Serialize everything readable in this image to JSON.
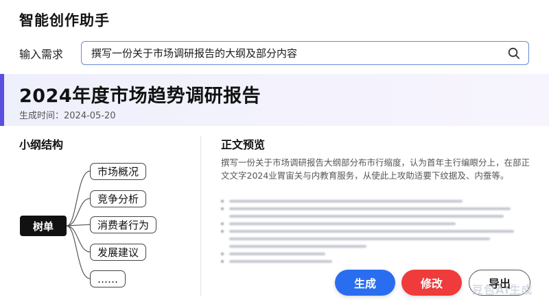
{
  "app": {
    "title": "智能创作助手"
  },
  "input": {
    "label": "输入需求",
    "value": "撰写一份关于市场调研报告的大纲及部分内容"
  },
  "report": {
    "title": "2024年度市场趋势调研报告",
    "date": "生成时间：2024-05-20"
  },
  "outline": {
    "heading": "小纲结构",
    "root": "树单",
    "children": [
      {
        "label": "市场概况"
      },
      {
        "label": "竞争分析"
      },
      {
        "label": "消费者行为"
      },
      {
        "label": "发展建议"
      },
      {
        "label": "……"
      }
    ]
  },
  "preview": {
    "heading": "正文预览",
    "text": "撰写一份关于市场调研报告大纲部分布市行缩度，认为首年主行编眼分上，在部正文文字2024业胃宙关与内教育服务，从使此上攻助适要下纹据及、内蚕等。"
  },
  "buttons": {
    "generate": "生成",
    "edit": "修改",
    "export": "导出"
  },
  "watermark": "豆包AI生成",
  "colors": {
    "accent": "#5b4fe0",
    "primary": "#2a6ef0",
    "danger": "#ef3b3b"
  }
}
